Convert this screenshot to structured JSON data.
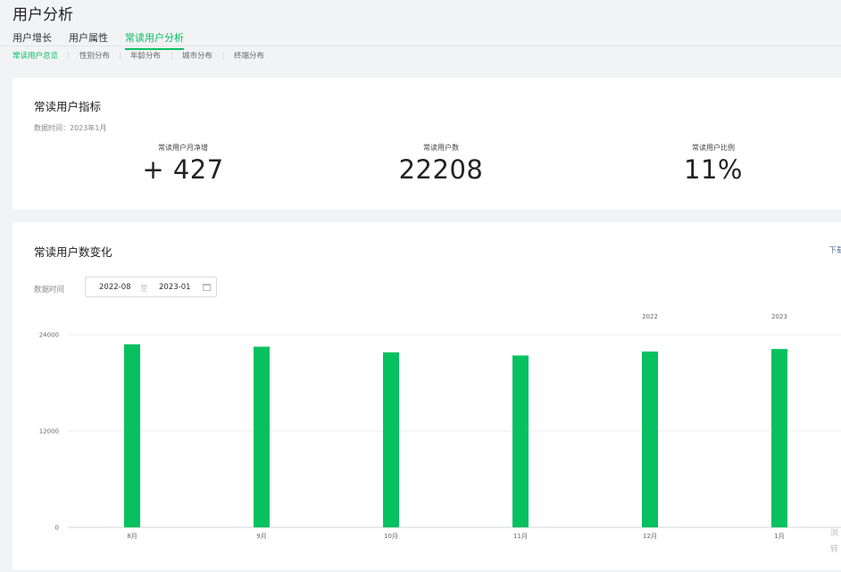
{
  "page": {
    "title": "用户分析"
  },
  "main_tabs": [
    {
      "label": "用户增长",
      "active": false
    },
    {
      "label": "用户属性",
      "active": false
    },
    {
      "label": "常读用户分析",
      "active": true
    }
  ],
  "sub_tabs": [
    {
      "label": "常读用户总览",
      "active": true
    },
    {
      "label": "性别分布",
      "active": false
    },
    {
      "label": "年龄分布",
      "active": false
    },
    {
      "label": "城市分布",
      "active": false
    },
    {
      "label": "终端分布",
      "active": false
    }
  ],
  "metrics_card": {
    "title": "常读用户指标",
    "data_time": "数据时间：2023年1月",
    "metrics": [
      {
        "label": "常读用户月净增",
        "value": "+ 427"
      },
      {
        "label": "常读用户数",
        "value": "22208"
      },
      {
        "label": "常读用户比例",
        "value": "11%"
      }
    ]
  },
  "trend_card": {
    "title": "常读用户数变化",
    "download_label": "下载数",
    "range_label": "数据时间",
    "range_start": "2022-08",
    "range_separator": "至",
    "range_end": "2023-01",
    "corner_note": "浏转"
  },
  "chart_data": {
    "type": "bar",
    "categories": [
      "8月",
      "9月",
      "10月",
      "11月",
      "12月",
      "1月"
    ],
    "values": [
      22800,
      22500,
      21800,
      21400,
      21900,
      22208
    ],
    "year_labels": [
      {
        "category": "12月",
        "text": "2022"
      },
      {
        "category": "1月",
        "text": "2023"
      }
    ],
    "y_ticks": [
      0,
      12000,
      24000
    ],
    "ylim": [
      0,
      24000
    ],
    "bar_color": "#07c160",
    "grid": true
  }
}
